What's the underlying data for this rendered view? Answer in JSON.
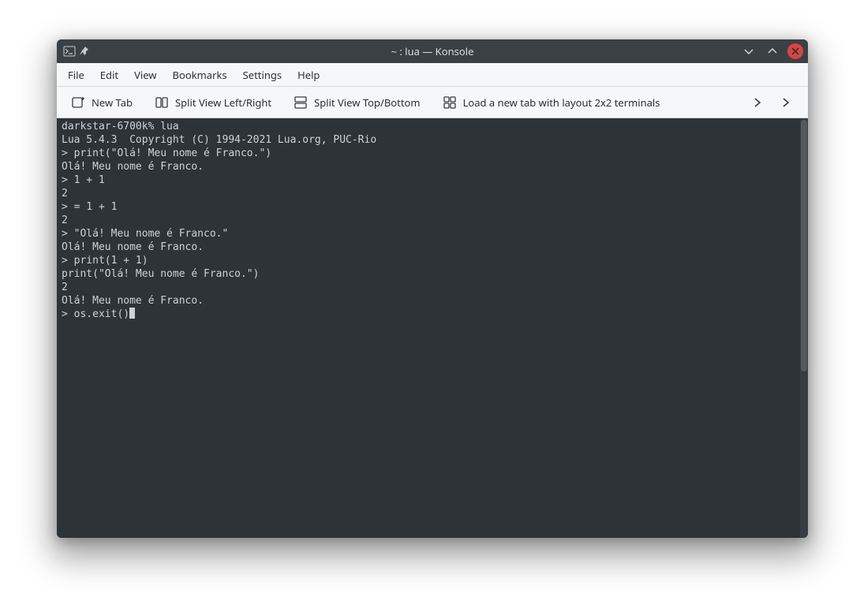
{
  "titlebar": {
    "title": "~ : lua — Konsole"
  },
  "menubar": {
    "items": [
      "File",
      "Edit",
      "View",
      "Bookmarks",
      "Settings",
      "Help"
    ]
  },
  "toolbar": {
    "new_tab": "New Tab",
    "split_lr": "Split View Left/Right",
    "split_tb": "Split View Top/Bottom",
    "layout_2x2": "Load a new tab with layout 2x2 terminals"
  },
  "terminal": {
    "lines": [
      "darkstar-6700k% lua",
      "Lua 5.4.3  Copyright (C) 1994-2021 Lua.org, PUC-Rio",
      "> print(\"Olá! Meu nome é Franco.\")",
      "Olá! Meu nome é Franco.",
      "> 1 + 1",
      "2",
      "> = 1 + 1",
      "2",
      "> \"Olá! Meu nome é Franco.\"",
      "Olá! Meu nome é Franco.",
      "> print(1 + 1)",
      "print(\"Olá! Meu nome é Franco.\")",
      "2",
      "Olá! Meu nome é Franco."
    ],
    "prompt_line": "> os.exit()"
  }
}
